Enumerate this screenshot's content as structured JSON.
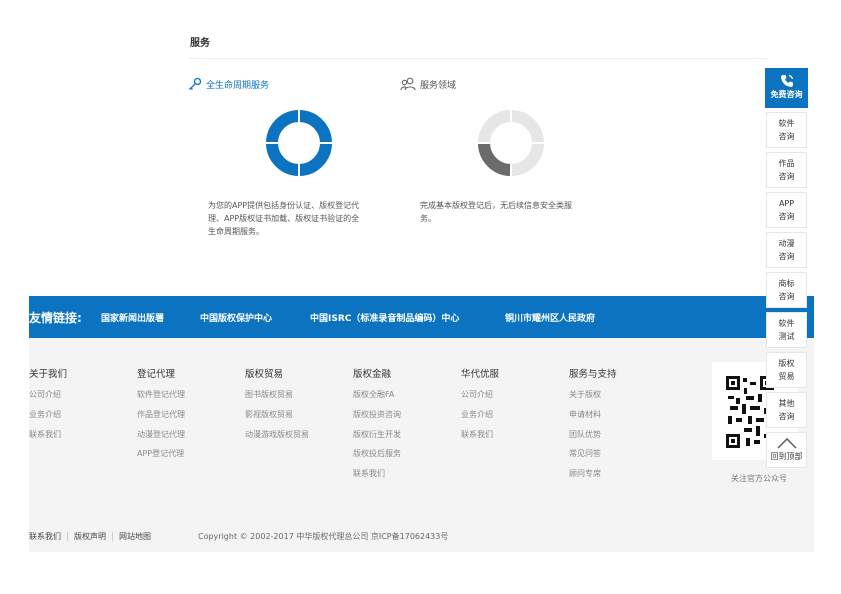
{
  "section": {
    "title": "服务"
  },
  "services": [
    {
      "heading": "全生命周期服务",
      "icon": "key-icon",
      "accent": "#0b73c0",
      "desc_lines": [
        "为您的APP提供包括身份认证、版权登记代",
        "理、APP版权证书加载、版权证书验证的全",
        "生命周期服务。"
      ]
    },
    {
      "heading": "服务领域",
      "icon": "users-icon",
      "accent": "#666666",
      "desc_lines": [
        "完成基本版权登记后，无后续信息安全类服",
        "务。"
      ]
    }
  ],
  "friend_links": {
    "label": "友情链接:",
    "items": [
      "国家新闻出版署",
      "中国版权保护中心",
      "中国ISRC（标准录音制品编码）中心",
      "铜川市耀州区人民政府"
    ]
  },
  "footer": {
    "columns": [
      {
        "title": "关于我们",
        "links": [
          "公司介绍",
          "业务介绍",
          "联系我们"
        ]
      },
      {
        "title": "登记代理",
        "links": [
          "软件登记代理",
          "作品登记代理",
          "动漫登记代理",
          "APP登记代理"
        ]
      },
      {
        "title": "版权贸易",
        "links": [
          "图书版权贸易",
          "影视版权贸易",
          "动漫游戏版权贸易"
        ]
      },
      {
        "title": "版权金融",
        "links": [
          "版权全融FA",
          "版权投资咨询",
          "版权衍生开发",
          "版权投后服务",
          "联系我们"
        ]
      },
      {
        "title": "华代优服",
        "links": [
          "公司介绍",
          "业务介绍",
          "联系我们"
        ]
      },
      {
        "title": "服务与支持",
        "links": [
          "关于版权",
          "申请材料",
          "团队优势",
          "常见问答",
          "顾问专席"
        ]
      }
    ],
    "qr_label": "关注官方公众号",
    "bottom_links": [
      "联系我们",
      "版权声明",
      "网站地图"
    ],
    "copyright": "Copyright © 2002-2017 中华版权代理总公司 京ICP备17062433号"
  },
  "sidebar": {
    "top": {
      "icon": "phone-icon",
      "label": "免费咨询"
    },
    "items": [
      [
        "软件",
        "咨询"
      ],
      [
        "作品",
        "咨询"
      ],
      [
        "APP",
        "咨询"
      ],
      [
        "动漫",
        "咨询"
      ],
      [
        "商标",
        "咨询"
      ],
      [
        "软件",
        "测试"
      ],
      [
        "版权",
        "贸易"
      ],
      [
        "其他",
        "咨询"
      ]
    ],
    "back_to_top": "回到顶部"
  },
  "colors": {
    "brand_blue": "#0b73c0",
    "footer_bg": "#f4f4f4",
    "donut_grey": "#e6e6e6",
    "donut_dark": "#6b6b6b"
  }
}
